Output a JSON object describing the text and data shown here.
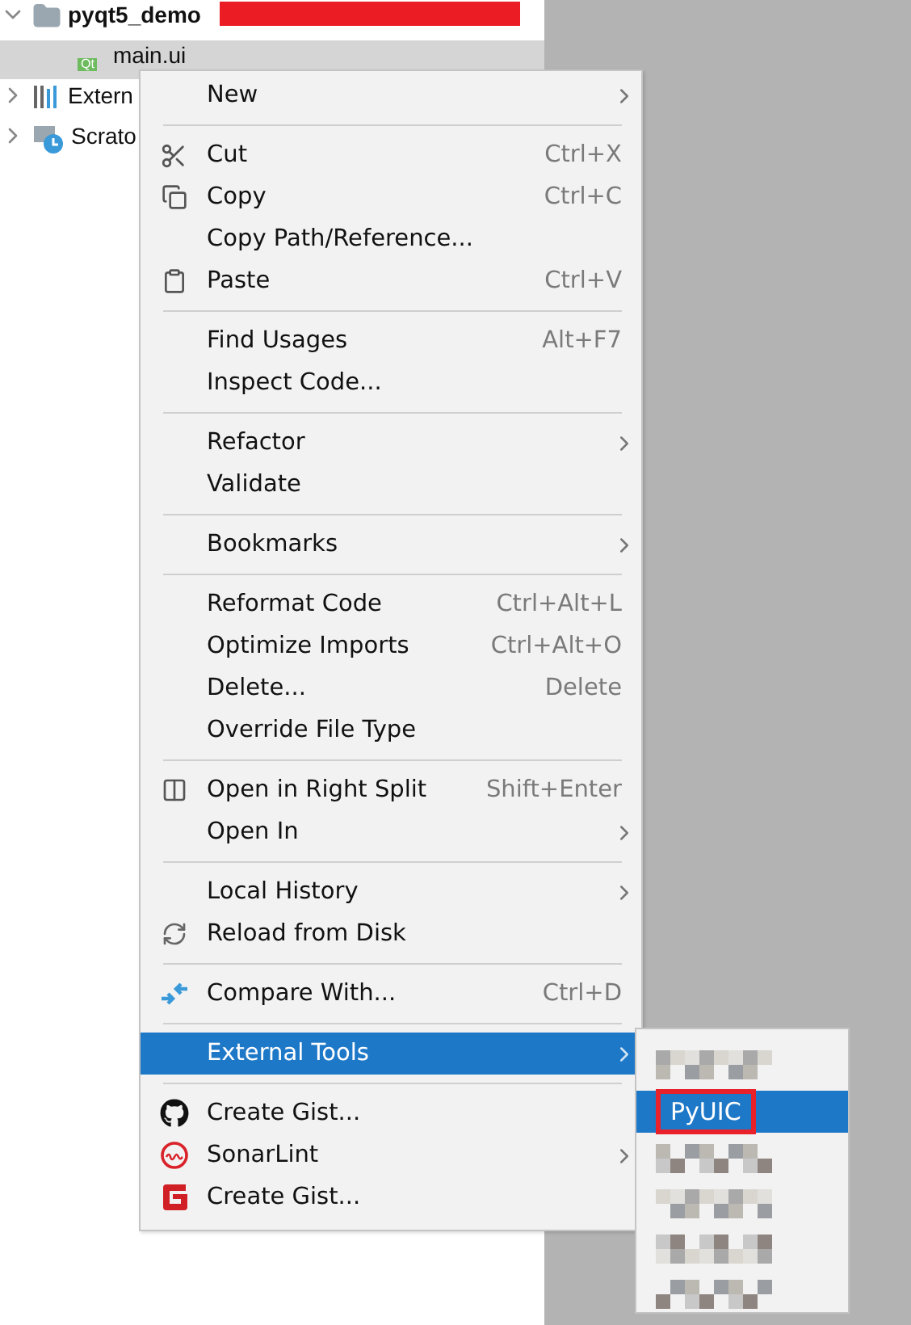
{
  "tree": {
    "items": [
      {
        "kind": "folder",
        "label": "pyqt5_demo",
        "expanded": true,
        "selected": false,
        "redacted": true
      },
      {
        "kind": "qt-file",
        "label": "main.ui",
        "badge": "Qt",
        "selected": true
      },
      {
        "kind": "library",
        "label": "Extern",
        "expanded": false,
        "selected": false
      },
      {
        "kind": "scratch",
        "label": "Scrato",
        "expanded": false,
        "selected": false
      }
    ]
  },
  "context_menu": {
    "items": [
      {
        "kind": "item",
        "label": "New",
        "submenu": true,
        "selected": false
      },
      {
        "kind": "separator"
      },
      {
        "kind": "item",
        "label": "Cut",
        "shortcut": "Ctrl+X",
        "selected": false
      },
      {
        "kind": "item",
        "label": "Copy",
        "shortcut": "Ctrl+C",
        "selected": false
      },
      {
        "kind": "item",
        "label": "Copy Path/Reference...",
        "selected": false
      },
      {
        "kind": "item",
        "label": "Paste",
        "shortcut": "Ctrl+V",
        "selected": false
      },
      {
        "kind": "separator"
      },
      {
        "kind": "item",
        "label": "Find Usages",
        "shortcut": "Alt+F7",
        "selected": false
      },
      {
        "kind": "item",
        "label": "Inspect Code...",
        "selected": false
      },
      {
        "kind": "separator"
      },
      {
        "kind": "item",
        "label": "Refactor",
        "submenu": true,
        "selected": false
      },
      {
        "kind": "item",
        "label": "Validate",
        "selected": false
      },
      {
        "kind": "separator"
      },
      {
        "kind": "item",
        "label": "Bookmarks",
        "submenu": true,
        "selected": false
      },
      {
        "kind": "separator"
      },
      {
        "kind": "item",
        "label": "Reformat Code",
        "shortcut": "Ctrl+Alt+L",
        "selected": false
      },
      {
        "kind": "item",
        "label": "Optimize Imports",
        "shortcut": "Ctrl+Alt+O",
        "selected": false
      },
      {
        "kind": "item",
        "label": "Delete...",
        "shortcut": "Delete",
        "selected": false
      },
      {
        "kind": "item",
        "label": "Override File Type",
        "selected": false
      },
      {
        "kind": "separator"
      },
      {
        "kind": "item",
        "label": "Open in Right Split",
        "shortcut": "Shift+Enter",
        "selected": false
      },
      {
        "kind": "item",
        "label": "Open In",
        "submenu": true,
        "selected": false
      },
      {
        "kind": "separator"
      },
      {
        "kind": "item",
        "label": "Local History",
        "submenu": true,
        "selected": false
      },
      {
        "kind": "item",
        "label": "Reload from Disk",
        "selected": false
      },
      {
        "kind": "separator"
      },
      {
        "kind": "item",
        "label": "Compare With...",
        "shortcut": "Ctrl+D",
        "selected": false
      },
      {
        "kind": "separator"
      },
      {
        "kind": "item",
        "label": "External Tools",
        "submenu": true,
        "selected": true
      },
      {
        "kind": "separator"
      },
      {
        "kind": "item",
        "label": "Create Gist...",
        "selected": false
      },
      {
        "kind": "item",
        "label": "SonarLint",
        "submenu": true,
        "selected": false
      },
      {
        "kind": "item",
        "label": "Create Gist...",
        "selected": false
      }
    ]
  },
  "submenu": {
    "items": [
      {
        "kind": "blurred"
      },
      {
        "kind": "item",
        "label": "PyUIC",
        "selected": true,
        "outlined": true
      },
      {
        "kind": "blurred"
      },
      {
        "kind": "blurred"
      },
      {
        "kind": "blurred"
      },
      {
        "kind": "blurred"
      }
    ]
  }
}
